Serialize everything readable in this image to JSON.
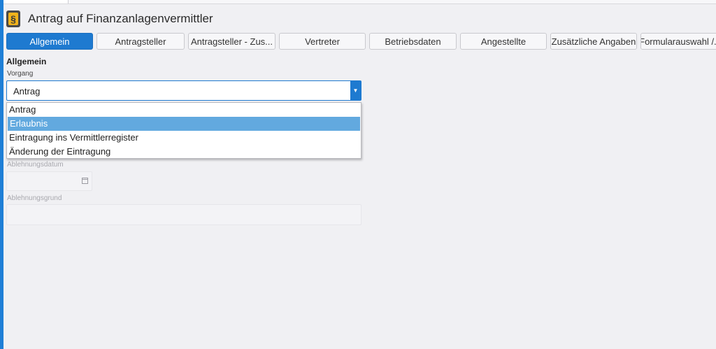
{
  "app": {
    "title": "Antrag auf Finanzanlagenvermittler",
    "icon": "paragraph-icon",
    "icon_glyph": "§"
  },
  "tabs": [
    {
      "label": "Allgemein",
      "active": true
    },
    {
      "label": "Antragsteller"
    },
    {
      "label": "Antragsteller - Zus..."
    },
    {
      "label": "Vertreter"
    },
    {
      "label": "Betriebsdaten"
    },
    {
      "label": "Angestellte"
    },
    {
      "label": "Zusätzliche Angaben"
    },
    {
      "label": "Formularauswahl /..."
    }
  ],
  "section": {
    "title": "Allgemein"
  },
  "vorgang": {
    "label": "Vorgang",
    "value": "Antrag",
    "options": [
      "Antrag",
      "Erlaubnis",
      "Eintragung ins Vermittlerregister",
      "Änderung der Eintragung"
    ],
    "highlighted": "Erlaubnis"
  },
  "ablehnungsdatum": {
    "label": "Ablehnungsdatum"
  },
  "ablehnungsgrund": {
    "label": "Ablehnungsgrund"
  },
  "colors": {
    "accent": "#1e7ad0",
    "highlight": "#62a9df",
    "background": "#f0f0f3"
  }
}
